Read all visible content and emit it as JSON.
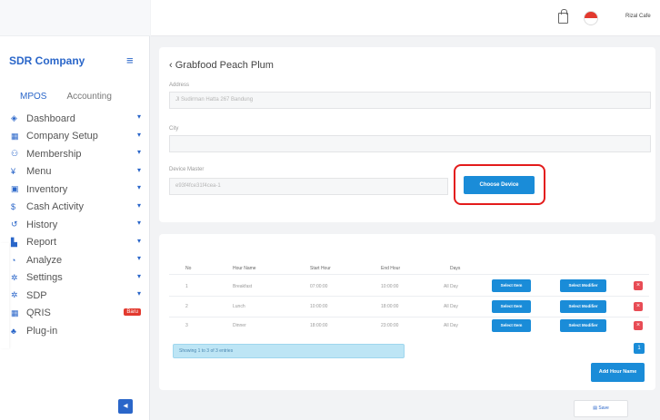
{
  "sidebar": {
    "brand": "SDR Company",
    "tabs": [
      "MPOS",
      "Accounting"
    ],
    "items": [
      {
        "label": "Dashboard",
        "icon": "dashboard-icon",
        "glyph": "◈"
      },
      {
        "label": "Company Setup",
        "icon": "building-icon",
        "glyph": "▦"
      },
      {
        "label": "Membership",
        "icon": "users-icon",
        "glyph": "⚇"
      },
      {
        "label": "Menu",
        "icon": "utensils-icon",
        "glyph": "¥"
      },
      {
        "label": "Inventory",
        "icon": "inventory-icon",
        "glyph": "▣"
      },
      {
        "label": "Cash Activity",
        "icon": "dollar-icon",
        "glyph": "$"
      },
      {
        "label": "History",
        "icon": "history-icon",
        "glyph": "↺"
      },
      {
        "label": "Report",
        "icon": "report-icon",
        "glyph": "▙"
      },
      {
        "label": "Analyze",
        "icon": "pie-chart-icon",
        "glyph": "◔"
      },
      {
        "label": "Settings",
        "icon": "gear-icon",
        "glyph": "✲"
      },
      {
        "label": "SDP",
        "icon": "sdp-icon",
        "glyph": "✲"
      },
      {
        "label": "QRIS",
        "icon": "qr-icon",
        "glyph": "▦"
      },
      {
        "label": "Plug-in",
        "icon": "plugin-icon",
        "glyph": "♣"
      }
    ],
    "qris_badge": "Baru",
    "collapse_glyph": "◂"
  },
  "topbar": {
    "username": "Rizal Cafe"
  },
  "form": {
    "back_title": "‹ Grabfood Peach Plum",
    "address_label": "Address",
    "address_value": "Jl Sudirman Hatta 267 Bandung",
    "city_label": "City",
    "city_value": "",
    "device_label": "Device Master",
    "device_value": "e93f4fce31f4cea-1",
    "choose_device": "Choose Device"
  },
  "table": {
    "headers": [
      "No",
      "Hour Name",
      "Start Hour",
      "End Hour",
      "Days"
    ],
    "rows": [
      {
        "no": "1",
        "name": "Breakfast",
        "start": "07:00:00",
        "end": "10:00:00",
        "days": "All Day"
      },
      {
        "no": "2",
        "name": "Lunch",
        "start": "10:00:00",
        "end": "18:00:00",
        "days": "All Day"
      },
      {
        "no": "3",
        "name": "Dinner",
        "start": "18:00:00",
        "end": "23:00:00",
        "days": "All Day"
      }
    ],
    "select_item": "Select Item",
    "select_modifier": "Select Modifier",
    "delete_glyph": "×",
    "showing": "Showing 1 to 3 of 3 entries",
    "page": "1",
    "add_hour_name": "Add Hour Name",
    "save": "Save"
  },
  "colors": {
    "accent": "#1a8cd8",
    "brand": "#2a66c9",
    "danger": "#e84c55",
    "highlight": "#e31b1b"
  }
}
